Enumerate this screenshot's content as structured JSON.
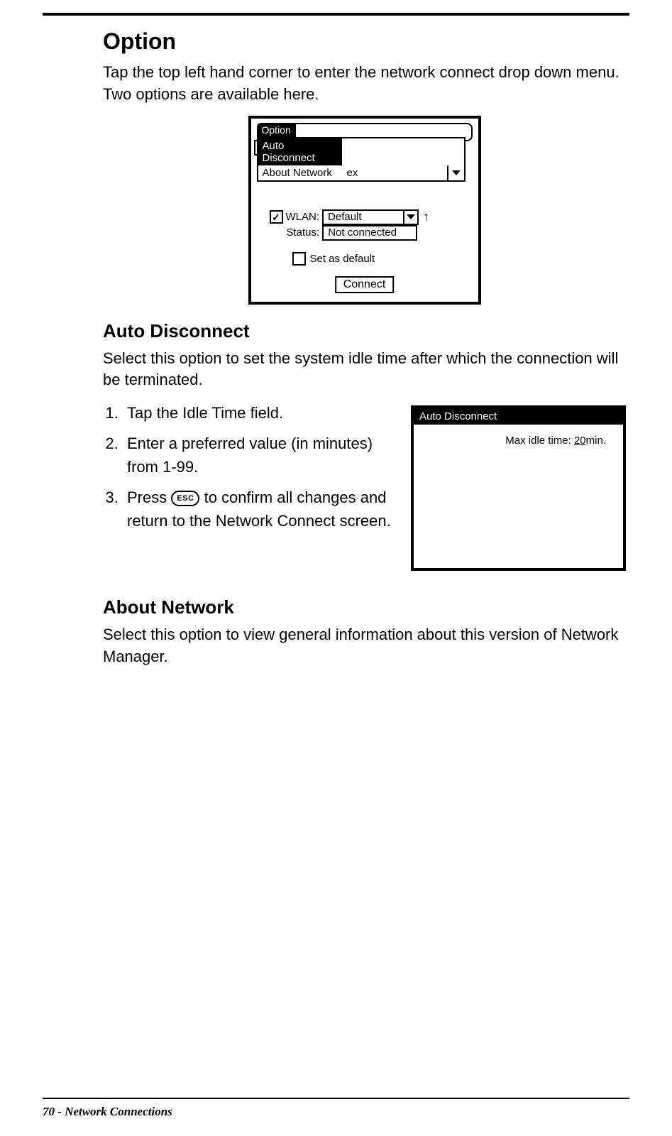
{
  "headings": {
    "option": "Option",
    "auto_disconnect": "Auto Disconnect",
    "about_network": "About Network"
  },
  "paragraphs": {
    "option_intro": "Tap the top left hand corner to enter the network connect drop down menu. Two options are available here.",
    "auto_disc_intro": "Select this option to set the system idle time after which the connection will be terminated.",
    "about_net_body": "Select this option to view general information about this version of Network Manager."
  },
  "steps": {
    "s1": "Tap the Idle Time field.",
    "s2": "Enter a preferred value (in minutes) from 1-99.",
    "s3a": "Press ",
    "s3_key": "ESC",
    "s3b": " to confirm all changes and return to the Network Connect screen."
  },
  "fig1": {
    "option_tab": "Option",
    "menu_auto_disconnect": "Auto Disconnect",
    "menu_about_network": "About Network",
    "menu_ex_fragment": "ex",
    "wlan_label": "WLAN:",
    "wlan_value": "Default",
    "status_label": "Status:",
    "status_value": "Not connected",
    "set_default_label": "Set as default",
    "connect_label": "Connect"
  },
  "fig2": {
    "title": "Auto Disconnect",
    "label": "Max idle time:  ",
    "value": "20",
    "unit": "min."
  },
  "footer": {
    "page": "70",
    "sep": "  -  ",
    "chapter": "Network Connections"
  }
}
